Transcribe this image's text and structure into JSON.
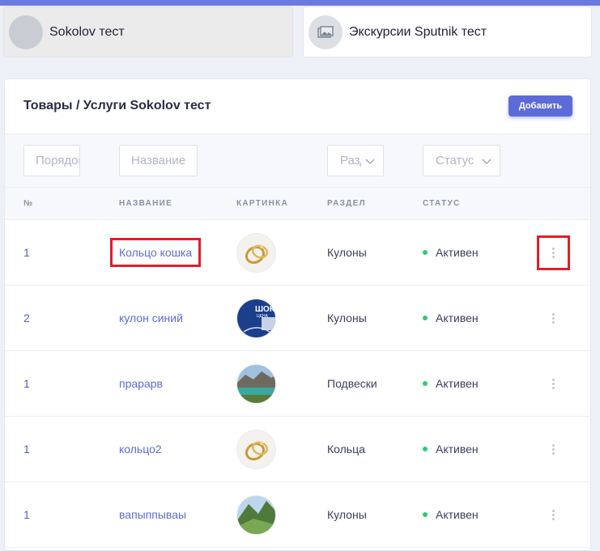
{
  "accounts": [
    {
      "name": "Sokolov тест",
      "active": true
    },
    {
      "name": "Экскурсии Sputnik тест",
      "active": false
    }
  ],
  "panel": {
    "title": "Товары / Услуги Sokolov тест",
    "add_label": "Добавить"
  },
  "filters": {
    "order_placeholder": "Порядок",
    "name_placeholder": "Название",
    "section_label": "Раздел",
    "status_label": "Статус"
  },
  "columns": {
    "num": "№",
    "name": "НАЗВАНИЕ",
    "image": "КАРТИНКА",
    "section": "РАЗДЕЛ",
    "status": "СТАТУС"
  },
  "rows": [
    {
      "num": "1",
      "name": "Кольцо кошка",
      "image": "ring-photo",
      "section": "Кулоны",
      "status": "Активен"
    },
    {
      "num": "2",
      "name": "кулон синий",
      "image": "blue-banner-photo",
      "section": "Кулоны",
      "status": "Активен"
    },
    {
      "num": "1",
      "name": "прарарв",
      "image": "mountain-lake-photo",
      "section": "Подвески",
      "status": "Активен"
    },
    {
      "num": "1",
      "name": "кольцо2",
      "image": "ring-photo",
      "section": "Кольца",
      "status": "Активен"
    },
    {
      "num": "1",
      "name": "вапыппываы",
      "image": "mountain-valley-photo",
      "section": "Кулоны",
      "status": "Активен"
    }
  ],
  "thumb_banner_text": [
    "ШОК",
    "ЦЕНА"
  ],
  "colors": {
    "accent": "#5c6bd8",
    "status_active": "#2ecc71",
    "highlight": "#e01e2b"
  }
}
